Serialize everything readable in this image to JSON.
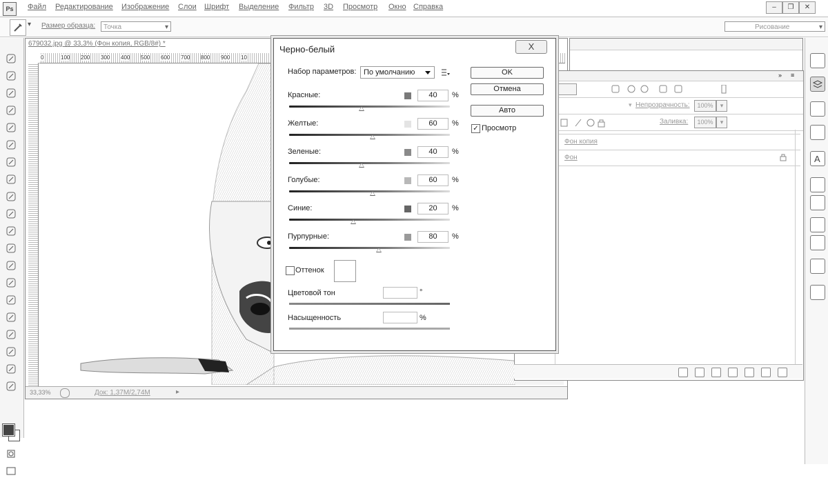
{
  "app": {
    "logo": "Ps"
  },
  "menu": [
    "Файл",
    "Редактирование",
    "Изображение",
    "Слои",
    "Шрифт",
    "Выделение",
    "Фильтр",
    "3D",
    "Просмотр",
    "Окно",
    "Справка"
  ],
  "options_bar": {
    "tool_preset": "Размер образца:",
    "sample_value": "Точка",
    "workspace": "Рисование"
  },
  "document": {
    "tab_title": "679032.jpg @ 33,3% (Фон копия, RGB/8#) *",
    "ruler_ticks": [
      "0",
      "100",
      "200",
      "300",
      "400",
      "500",
      "600",
      "700",
      "800",
      "900",
      "10"
    ],
    "status": "Док: 1,37М/2,74М"
  },
  "layers_panel": {
    "opacity_label": "Непрозрачность:",
    "opacity_value": "100%",
    "fill_label": "Заливка:",
    "fill_value": "100%",
    "layers": [
      "Фон копия",
      "Фон"
    ]
  },
  "dialog": {
    "title": "Черно-белый",
    "close": "X",
    "preset_label": "Набор параметров:",
    "preset_value": "По умолчанию",
    "ok": "OK",
    "cancel": "Отмена",
    "auto": "Авто",
    "preview_label": "Просмотр",
    "preview_checked": true,
    "percent": "%",
    "channels": [
      {
        "label": "Красные:",
        "value": "40",
        "slider_pos": 0.45,
        "color": "#7a7a7a"
      },
      {
        "label": "Желтые:",
        "value": "60",
        "slider_pos": 0.52,
        "color": "#e4e4e4"
      },
      {
        "label": "Зеленые:",
        "value": "40",
        "slider_pos": 0.45,
        "color": "#8a8a8a"
      },
      {
        "label": "Голубые:",
        "value": "60",
        "slider_pos": 0.52,
        "color": "#b8b8b8"
      },
      {
        "label": "Синие:",
        "value": "20",
        "slider_pos": 0.4,
        "color": "#666666"
      },
      {
        "label": "Пурпурные:",
        "value": "80",
        "slider_pos": 0.56,
        "color": "#9a9a9a"
      }
    ],
    "tint_label": "Оттенок",
    "tint_checked": false,
    "hue_label": "Цветовой тон",
    "hue_unit": "°",
    "saturation_label": "Насыщенность",
    "saturation_unit": "%"
  }
}
